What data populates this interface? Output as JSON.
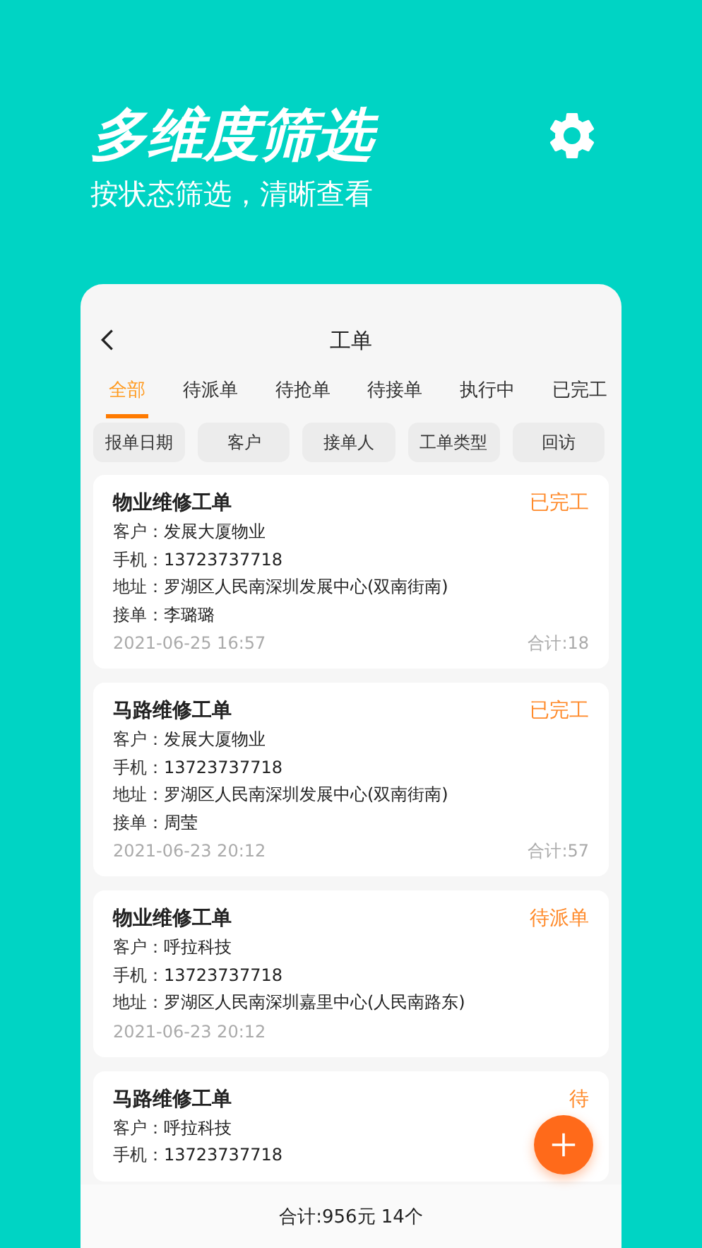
{
  "hero": {
    "title": "多维度筛选",
    "subtitle": "按状态筛选，清晰查看"
  },
  "page_title": "工单",
  "tabs": [
    {
      "label": "全部",
      "selected": true
    },
    {
      "label": "待派单",
      "selected": false
    },
    {
      "label": "待抢单",
      "selected": false
    },
    {
      "label": "待接单",
      "selected": false
    },
    {
      "label": "执行中",
      "selected": false
    },
    {
      "label": "已完工",
      "selected": false
    }
  ],
  "filters": [
    "报单日期",
    "客户",
    "接单人",
    "工单类型",
    "回访"
  ],
  "orders": [
    {
      "title": "物业维修工单",
      "status": "已完工",
      "fields": [
        {
          "label": "客户：",
          "value": "发展大厦物业"
        },
        {
          "label": "手机：",
          "value": "13723737718"
        },
        {
          "label": "地址：",
          "value": "罗湖区人民南深圳发展中心(双南街南)"
        },
        {
          "label": "接单：",
          "value": "李璐璐"
        }
      ],
      "date": "2021-06-25 16:57",
      "total": "合计:18"
    },
    {
      "title": "马路维修工单",
      "status": "已完工",
      "fields": [
        {
          "label": "客户：",
          "value": "发展大厦物业"
        },
        {
          "label": "手机：",
          "value": "13723737718"
        },
        {
          "label": "地址：",
          "value": "罗湖区人民南深圳发展中心(双南街南)"
        },
        {
          "label": "接单：",
          "value": "周莹"
        }
      ],
      "date": "2021-06-23 20:12",
      "total": "合计:57"
    },
    {
      "title": "物业维修工单",
      "status": "待派单",
      "fields": [
        {
          "label": "客户：",
          "value": "呼拉科技"
        },
        {
          "label": "手机：",
          "value": "13723737718"
        },
        {
          "label": "地址：",
          "value": "罗湖区人民南深圳嘉里中心(人民南路东)"
        }
      ],
      "date": "2021-06-23 20:12"
    },
    {
      "title": "马路维修工单",
      "status": "待",
      "fields": [
        {
          "label": "客户：",
          "value": "呼拉科技"
        },
        {
          "label": "手机：",
          "value": "13723737718"
        }
      ]
    }
  ],
  "summary": "合计:956元 14个"
}
